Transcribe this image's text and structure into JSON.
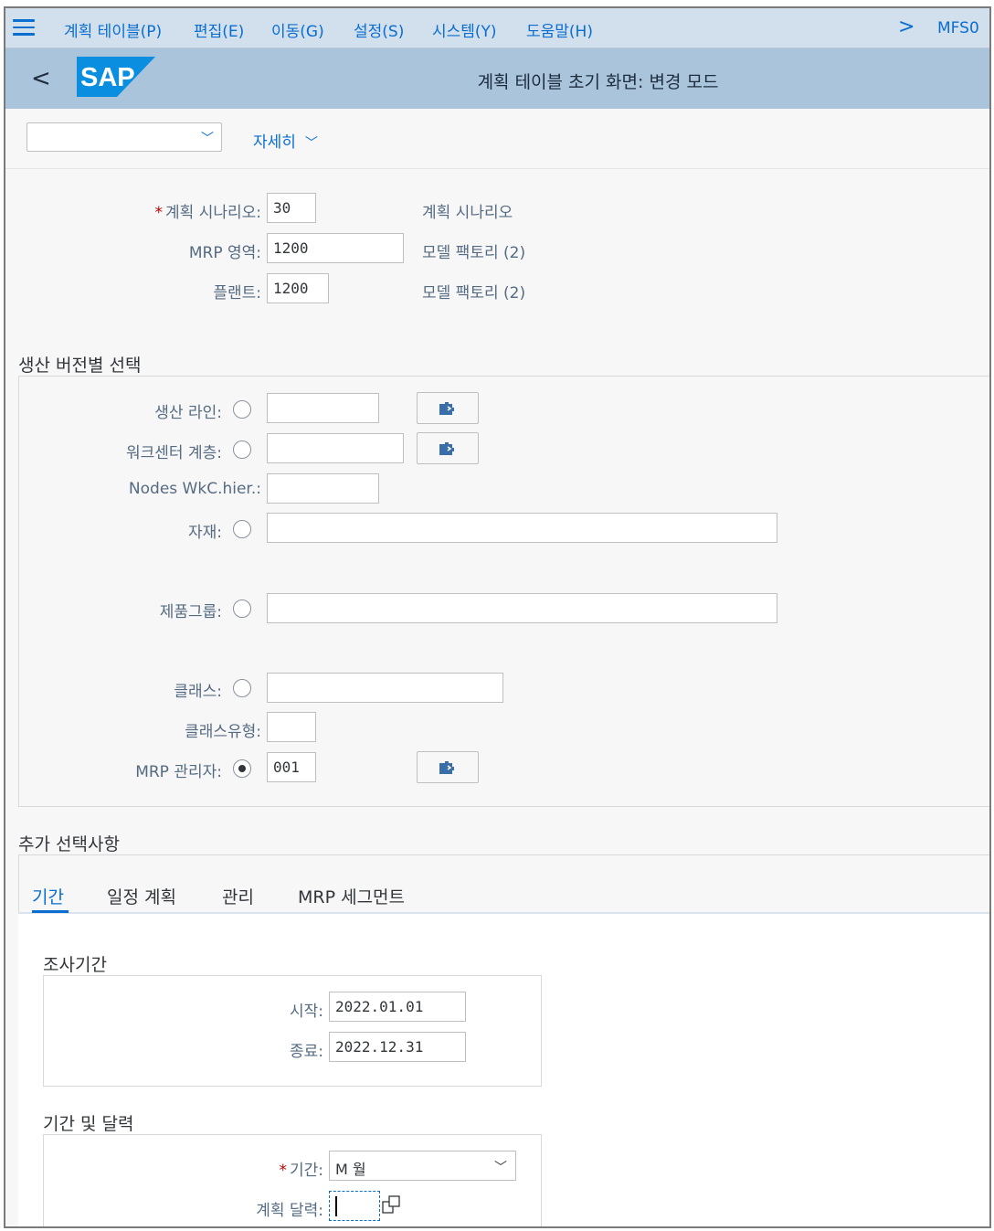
{
  "menubar": {
    "items": [
      {
        "label": "계획 테이블(P)"
      },
      {
        "label": "편집(E)"
      },
      {
        "label": "이동(G)"
      },
      {
        "label": "설정(S)"
      },
      {
        "label": "시스템(Y)"
      },
      {
        "label": "도움말(H)"
      }
    ],
    "tcode": "MFS0",
    "chevron": ">"
  },
  "header": {
    "back": "<",
    "logo_text": "SAP",
    "title": "계획 테이블 초기 화면: 변경 모드"
  },
  "toolbar": {
    "variant_value": "",
    "more_label": "자세히"
  },
  "top_fields": {
    "scenario": {
      "label": "계획 시나리오:",
      "value": "30",
      "desc": "계획 시나리오",
      "required": "*"
    },
    "mrp_area": {
      "label": "MRP 영역:",
      "value": "1200",
      "desc": "모델 팩토리 (2)"
    },
    "plant": {
      "label": "플랜트:",
      "value": "1200",
      "desc": "모델 팩토리 (2)"
    }
  },
  "production_version": {
    "title": "생산 버전별 선택",
    "line": {
      "label": "생산 라인:",
      "value": "",
      "selected": false
    },
    "wc_hier": {
      "label": "워크센터 계층:",
      "value": "",
      "selected": false
    },
    "nodes": {
      "label": "Nodes WkC.hier.:",
      "value": ""
    },
    "material": {
      "label": "자재:",
      "value": "",
      "selected": false
    },
    "product_group": {
      "label": "제품그룹:",
      "value": "",
      "selected": false
    },
    "class": {
      "label": "클래스:",
      "value": "",
      "selected": false
    },
    "class_type": {
      "label": "클래스유형:",
      "value": ""
    },
    "mrp_controller": {
      "label": "MRP 관리자:",
      "value": "001",
      "selected": true
    }
  },
  "additional": {
    "title": "추가 선택사항",
    "tabs": [
      {
        "label": "기간",
        "active": true
      },
      {
        "label": "일정 계획"
      },
      {
        "label": "관리"
      },
      {
        "label": "MRP 세그먼트"
      }
    ],
    "eval_period": {
      "title": "조사기간",
      "start": {
        "label": "시작:",
        "value": "2022.01.01"
      },
      "end": {
        "label": "종료:",
        "value": "2022.12.31"
      }
    },
    "period_calendar": {
      "title": "기간 및 달력",
      "period": {
        "label": "기간:",
        "value": "M 월",
        "required": "*"
      },
      "calendar": {
        "label": "계획 달력:",
        "value": ""
      }
    }
  },
  "colors": {
    "menubar_bg": "#d2dfec",
    "header_bg": "#aac4dc",
    "accent": "#0a6ed1",
    "required": "#bb0000"
  }
}
